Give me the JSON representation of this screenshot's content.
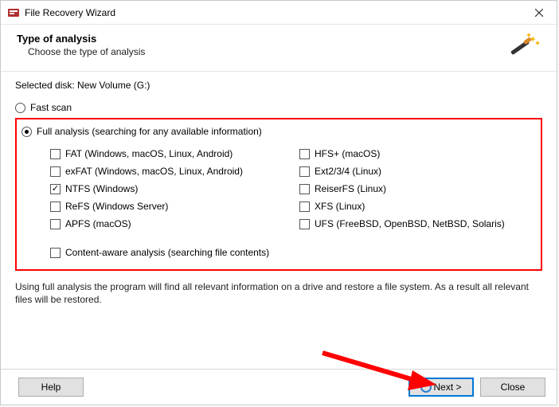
{
  "window": {
    "title": "File Recovery Wizard"
  },
  "header": {
    "title": "Type of analysis",
    "subtitle": "Choose the type of analysis"
  },
  "selected_disk_label": "Selected disk: New Volume (G:)",
  "scan": {
    "fast_label": "Fast scan",
    "full_label": "Full analysis (searching for any available information)"
  },
  "filesystems": {
    "left": [
      {
        "label": "FAT (Windows, macOS, Linux, Android)",
        "checked": false
      },
      {
        "label": "exFAT (Windows, macOS, Linux, Android)",
        "checked": false
      },
      {
        "label": "NTFS (Windows)",
        "checked": true
      },
      {
        "label": "ReFS (Windows Server)",
        "checked": false
      },
      {
        "label": "APFS (macOS)",
        "checked": false
      }
    ],
    "right": [
      {
        "label": "HFS+ (macOS)",
        "checked": false
      },
      {
        "label": "Ext2/3/4 (Linux)",
        "checked": false
      },
      {
        "label": "ReiserFS (Linux)",
        "checked": false
      },
      {
        "label": "XFS (Linux)",
        "checked": false
      },
      {
        "label": "UFS (FreeBSD, OpenBSD, NetBSD, Solaris)",
        "checked": false
      }
    ]
  },
  "content_aware_label": "Content-aware analysis (searching file contents)",
  "info_text": "Using full analysis the program will find all relevant information on a drive and restore a file system. As a result all relevant files will be restored.",
  "buttons": {
    "help": "Help",
    "next": "Next >",
    "close": "Close"
  }
}
